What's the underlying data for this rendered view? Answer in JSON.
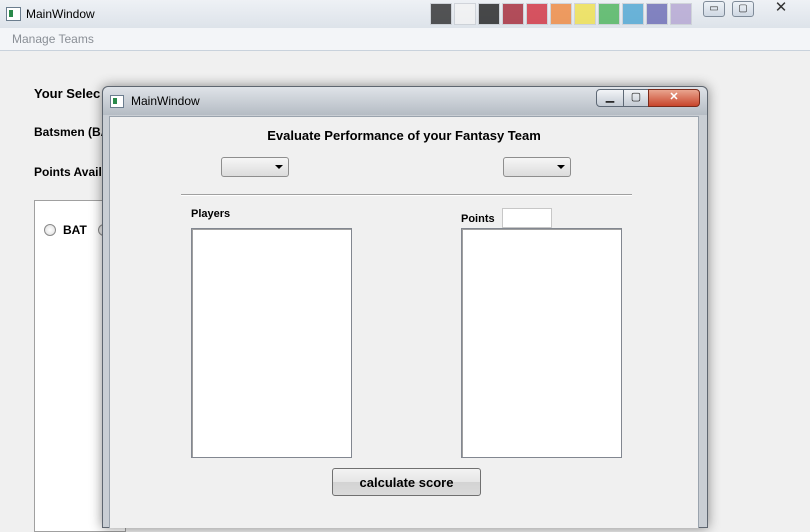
{
  "main_window": {
    "title": "MainWindow",
    "controls": {
      "minimize": "▭",
      "maximize": "▢",
      "close": "✕"
    },
    "swatch_colors": [
      "#202020",
      "#f4f4f4",
      "#111111",
      "#a01828",
      "#d02030",
      "#f08030",
      "#f0e040",
      "#40b050",
      "#40a0d0",
      "#6060b0",
      "#b0a0d0"
    ],
    "menu": {
      "manage_teams": "Manage Teams"
    },
    "your_selection_label": "Your Selec",
    "batsmen_label": "Batsmen (BA",
    "points_available_label": "Points Availa",
    "radio_bat_label": "BAT"
  },
  "dialog": {
    "title": "MainWindow",
    "controls": {
      "minimize": "▁",
      "maximize": "▢",
      "close": "✕"
    },
    "heading": "Evaluate Performance of your Fantasy Team",
    "left_combo_value": "",
    "right_combo_value": "",
    "players_label": "Players",
    "points_label": "Points",
    "points_value": "",
    "players_items": [],
    "points_items": [],
    "calculate_button": "calculate score"
  },
  "colors": {
    "window_bg": "#f0f0f0",
    "close_button": "#c8452b",
    "list_bg": "#ffffff"
  }
}
